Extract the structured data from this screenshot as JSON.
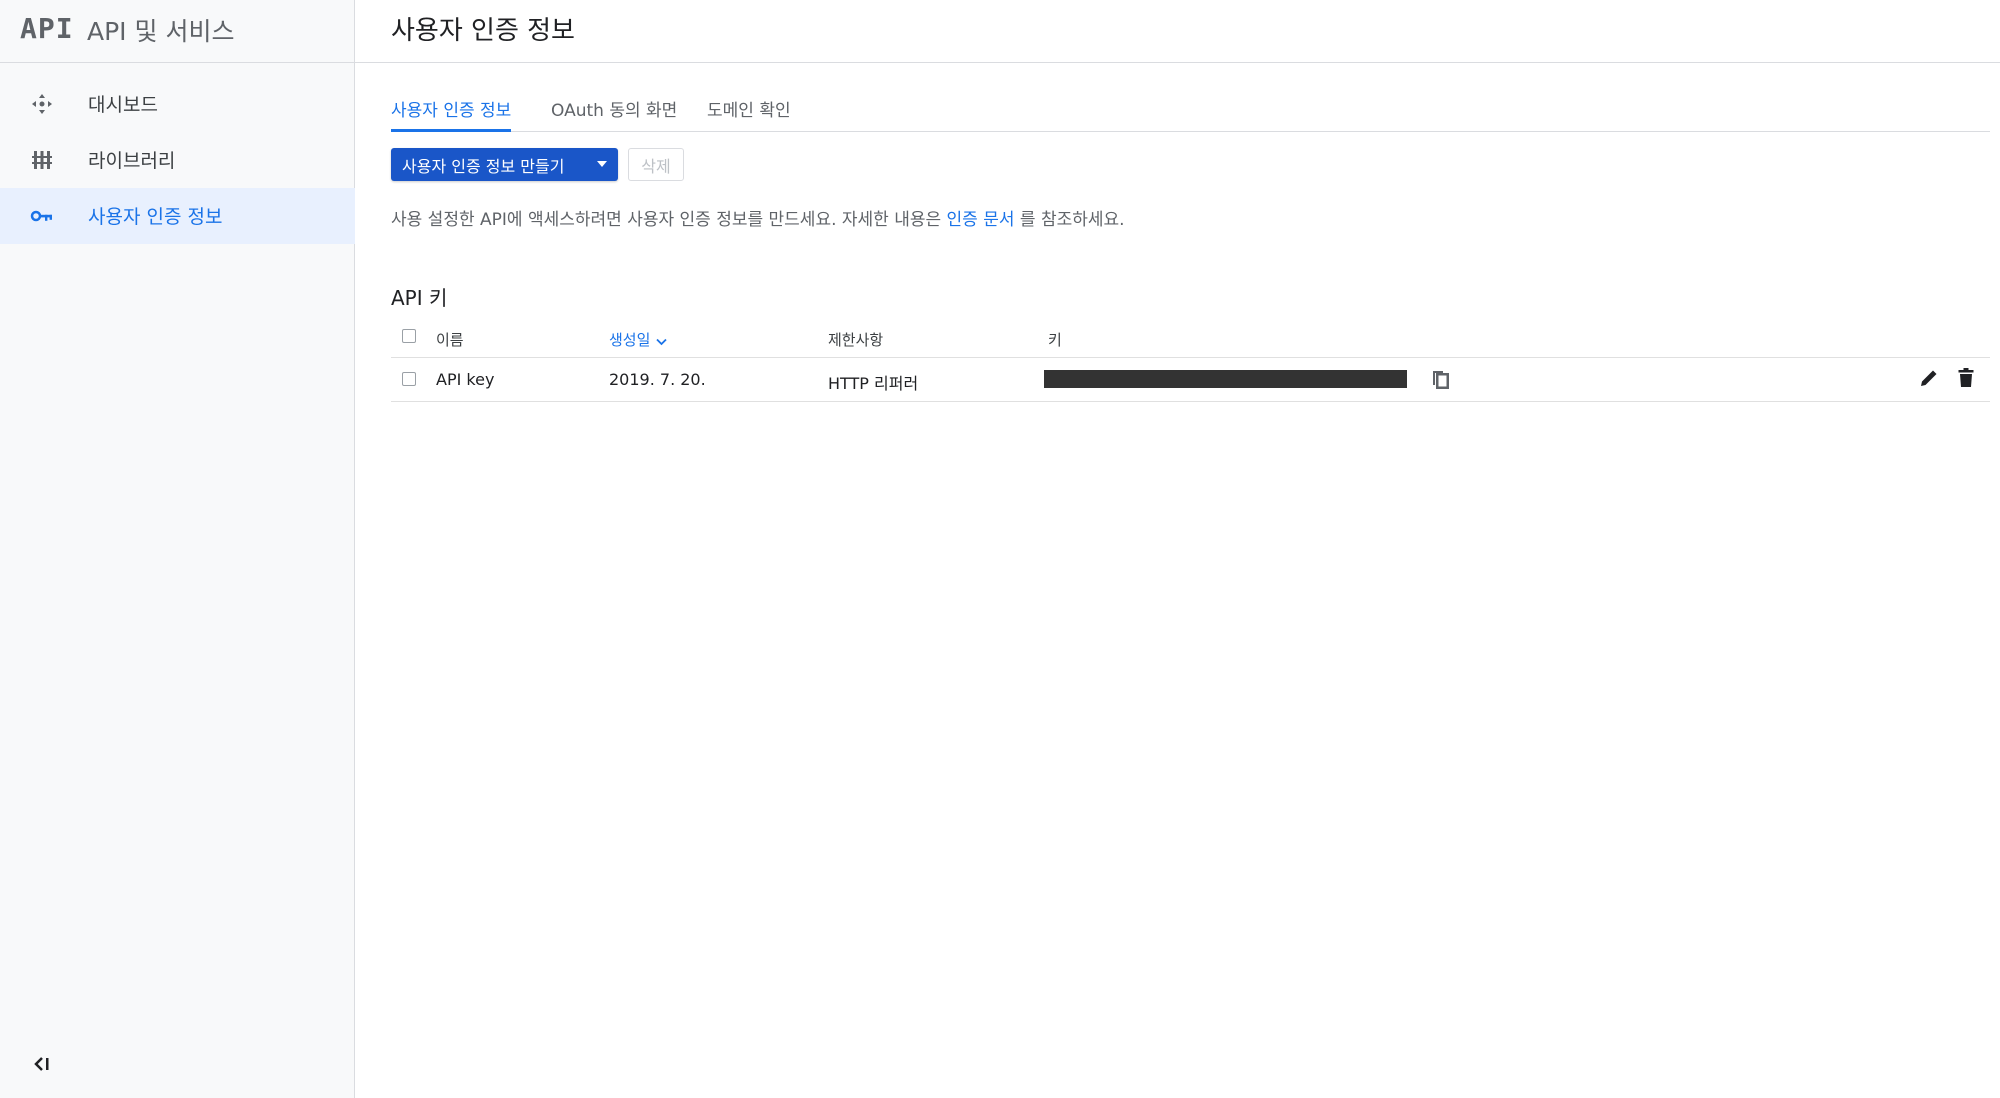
{
  "sidebar": {
    "logo": "API",
    "product_name": "API 및 서비스",
    "items": [
      {
        "label": "대시보드",
        "icon": "dashboard-icon"
      },
      {
        "label": "라이브러리",
        "icon": "library-icon"
      },
      {
        "label": "사용자 인증 정보",
        "icon": "key-icon",
        "active": true
      }
    ],
    "collapse_icon": "collapse-sidebar-icon"
  },
  "header": {
    "title": "사용자 인증 정보"
  },
  "tabs": [
    {
      "label": "사용자 인증 정보",
      "active": true
    },
    {
      "label": "OAuth 동의 화면"
    },
    {
      "label": "도메인 확인"
    }
  ],
  "toolbar": {
    "create_label": "사용자 인증 정보 만들기",
    "delete_label": "삭제"
  },
  "description": {
    "before": "사용 설정한 API에 액세스하려면 사용자 인증 정보를 만드세요. 자세한 내용은 ",
    "link": "인증 문서",
    "after": " 를 참조하세요."
  },
  "api_keys": {
    "title": "API 키",
    "columns": {
      "name": "이름",
      "created": "생성일",
      "restrictions": "제한사항",
      "key": "키"
    },
    "rows": [
      {
        "name": "API key",
        "created": "2019. 7. 20.",
        "restrictions": "HTTP 리퍼러"
      }
    ]
  },
  "colors": {
    "accent": "#1a73e8",
    "primary_button": "#1a56c8",
    "active_nav_bg": "#e8f0fe",
    "masked_key": "#333333"
  }
}
